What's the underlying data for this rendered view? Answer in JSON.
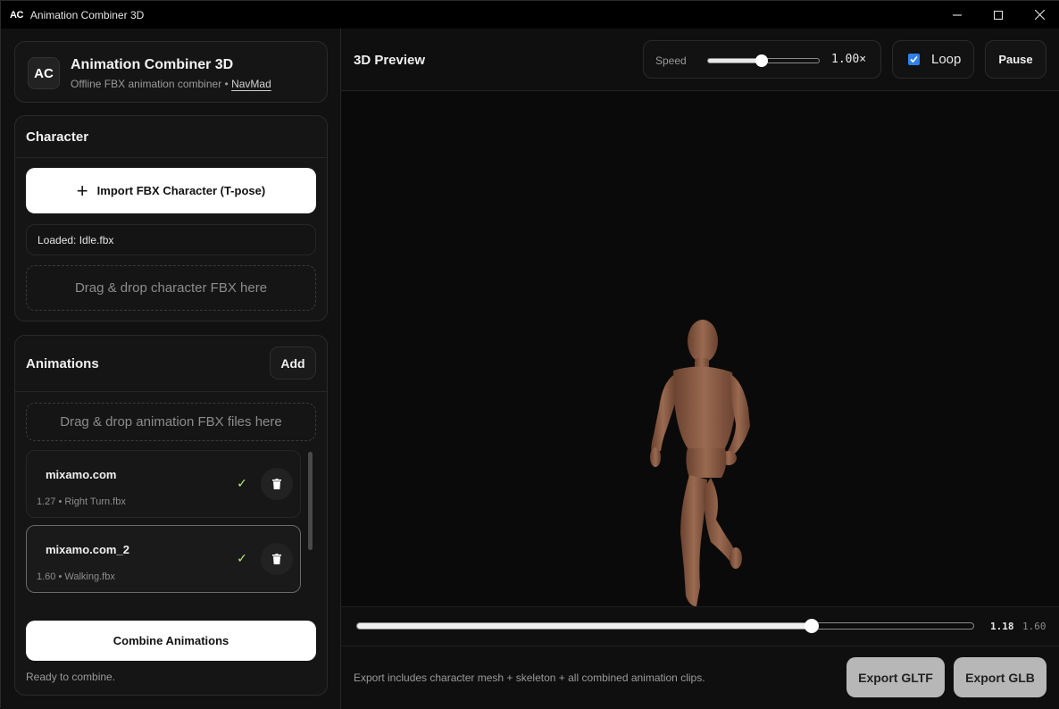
{
  "window": {
    "icon_text": "AC",
    "title": "Animation Combiner 3D",
    "controls": {
      "minimize": "minimize-icon",
      "maximize": "maximize-icon",
      "close": "close-icon"
    }
  },
  "brand": {
    "logo": "AC",
    "title": "Animation Combiner 3D",
    "subtitle": "Offline FBX animation combiner •",
    "link": "NavMad"
  },
  "character": {
    "heading": "Character",
    "import_label": "Import FBX Character (T-pose)",
    "loaded_text": "Loaded: Idle.fbx",
    "drop_text": "Drag & drop character FBX here"
  },
  "animations": {
    "heading": "Animations",
    "add_label": "Add",
    "drop_text": "Drag & drop animation FBX files here",
    "items": [
      {
        "name": "mixamo.com",
        "meta": "1.27 • Right Turn.fbx",
        "check": "✓",
        "selected": false
      },
      {
        "name": "mixamo.com_2",
        "meta": "1.60 • Walking.fbx",
        "check": "✓",
        "selected": true
      }
    ],
    "scroll_fraction": 0.66,
    "combine_label": "Combine Animations",
    "status": "Ready to combine."
  },
  "preview": {
    "title": "3D Preview",
    "speed_label": "Speed",
    "speed_slider_fraction": 0.48,
    "speed_value": "1.00×",
    "loop_label": "Loop",
    "loop_checked": true,
    "pause_label": "Pause"
  },
  "timeline": {
    "current": "1.18",
    "total": "1.60",
    "progress_fraction": 0.7375
  },
  "footer": {
    "note": "Export includes character mesh + skeleton + all combined animation clips.",
    "export_gltf": "Export GLTF",
    "export_glb": "Export GLB"
  },
  "colors": {
    "accent_check": "#b8f07a",
    "checkbox": "#2f80ed",
    "skin": "#8a5a42",
    "export_button": "#b7b7b7"
  }
}
